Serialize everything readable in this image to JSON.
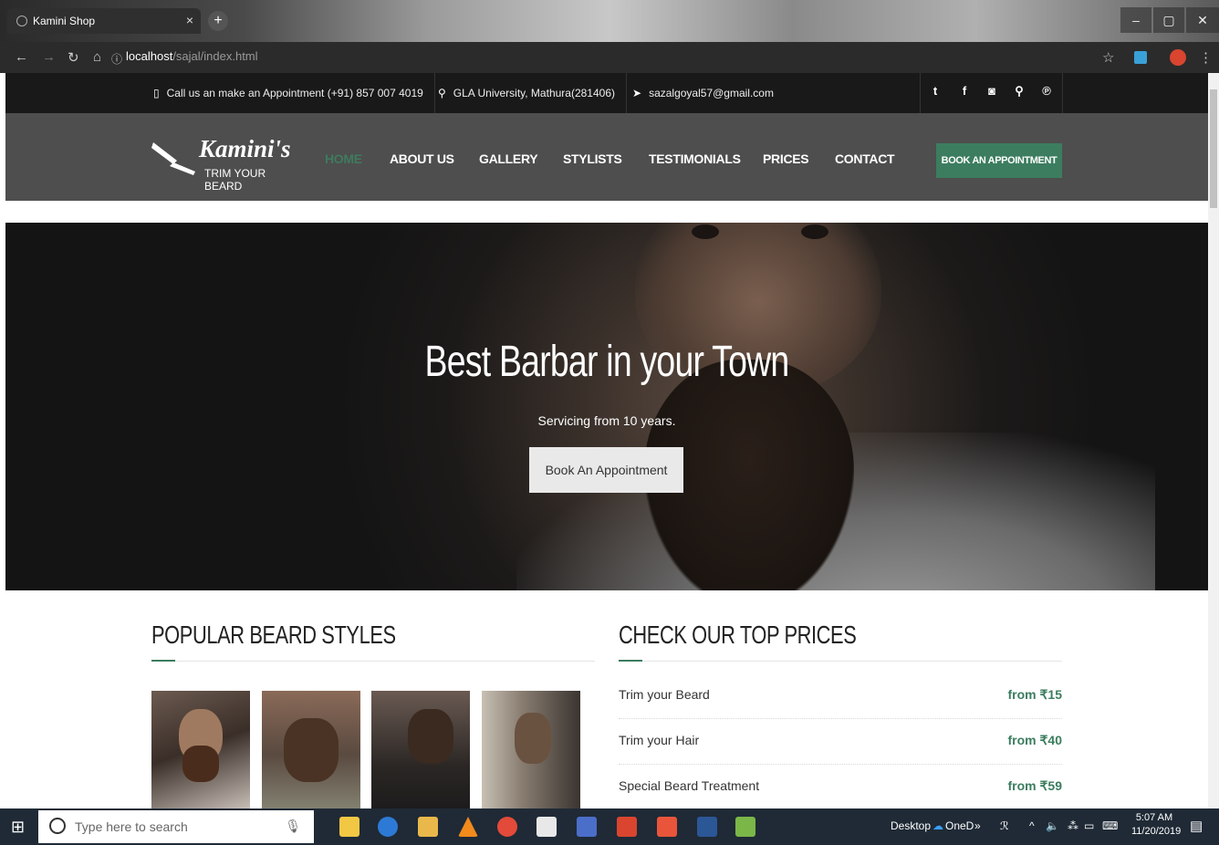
{
  "browser": {
    "tab_title": "Kamini Shop",
    "tab_close": "×",
    "new_tab": "+",
    "url_host": "localhost",
    "url_path": "/sajal/index.html",
    "window_controls": [
      "–",
      "▢",
      "✕"
    ]
  },
  "topinfo": {
    "phone_text": "Call us an make an Appointment (+91) 857 007 4019",
    "address_text": "GLA University, Mathura(281406)",
    "email_text": "sazalgoyal57@gmail.com",
    "social_icons": [
      "twitter-icon",
      "facebook-icon",
      "instagram-icon",
      "map-pin-icon",
      "pinterest-icon"
    ]
  },
  "logo": {
    "name": "Kamini's",
    "tagline": "TRIM YOUR BEARD"
  },
  "nav": {
    "items": [
      {
        "label": "HOME",
        "active": true
      },
      {
        "label": "ABOUT US",
        "active": false
      },
      {
        "label": "GALLERY",
        "active": false
      },
      {
        "label": "STYLISTS",
        "active": false
      },
      {
        "label": "TESTIMONIALS",
        "active": false
      },
      {
        "label": "PRICES",
        "active": false
      },
      {
        "label": "CONTACT",
        "active": false
      }
    ],
    "book_button": "BOOK AN APPOINTMENT"
  },
  "hero": {
    "title": "Best Barbar in your Town",
    "subtitle": "Servicing from 10 years.",
    "button": "Book An Appointment"
  },
  "sections": {
    "styles_title": "POPULAR BEARD STYLES",
    "prices_title": "CHECK OUR TOP PRICES"
  },
  "prices": [
    {
      "label": "Trim your Beard",
      "value": "from ₹15"
    },
    {
      "label": "Trim your Hair",
      "value": "from ₹40"
    },
    {
      "label": "Special Beard Treatment",
      "value": "from ₹59"
    }
  ],
  "colors": {
    "accent": "#3c7d5f",
    "header_bg": "#4e4e4e",
    "topbar_bg": "#191919"
  },
  "taskbar": {
    "search_placeholder": "Type here to search",
    "desktop_label": "Desktop",
    "onedrive_label": "OneD",
    "time": "5:07 AM",
    "date": "11/20/2019"
  }
}
